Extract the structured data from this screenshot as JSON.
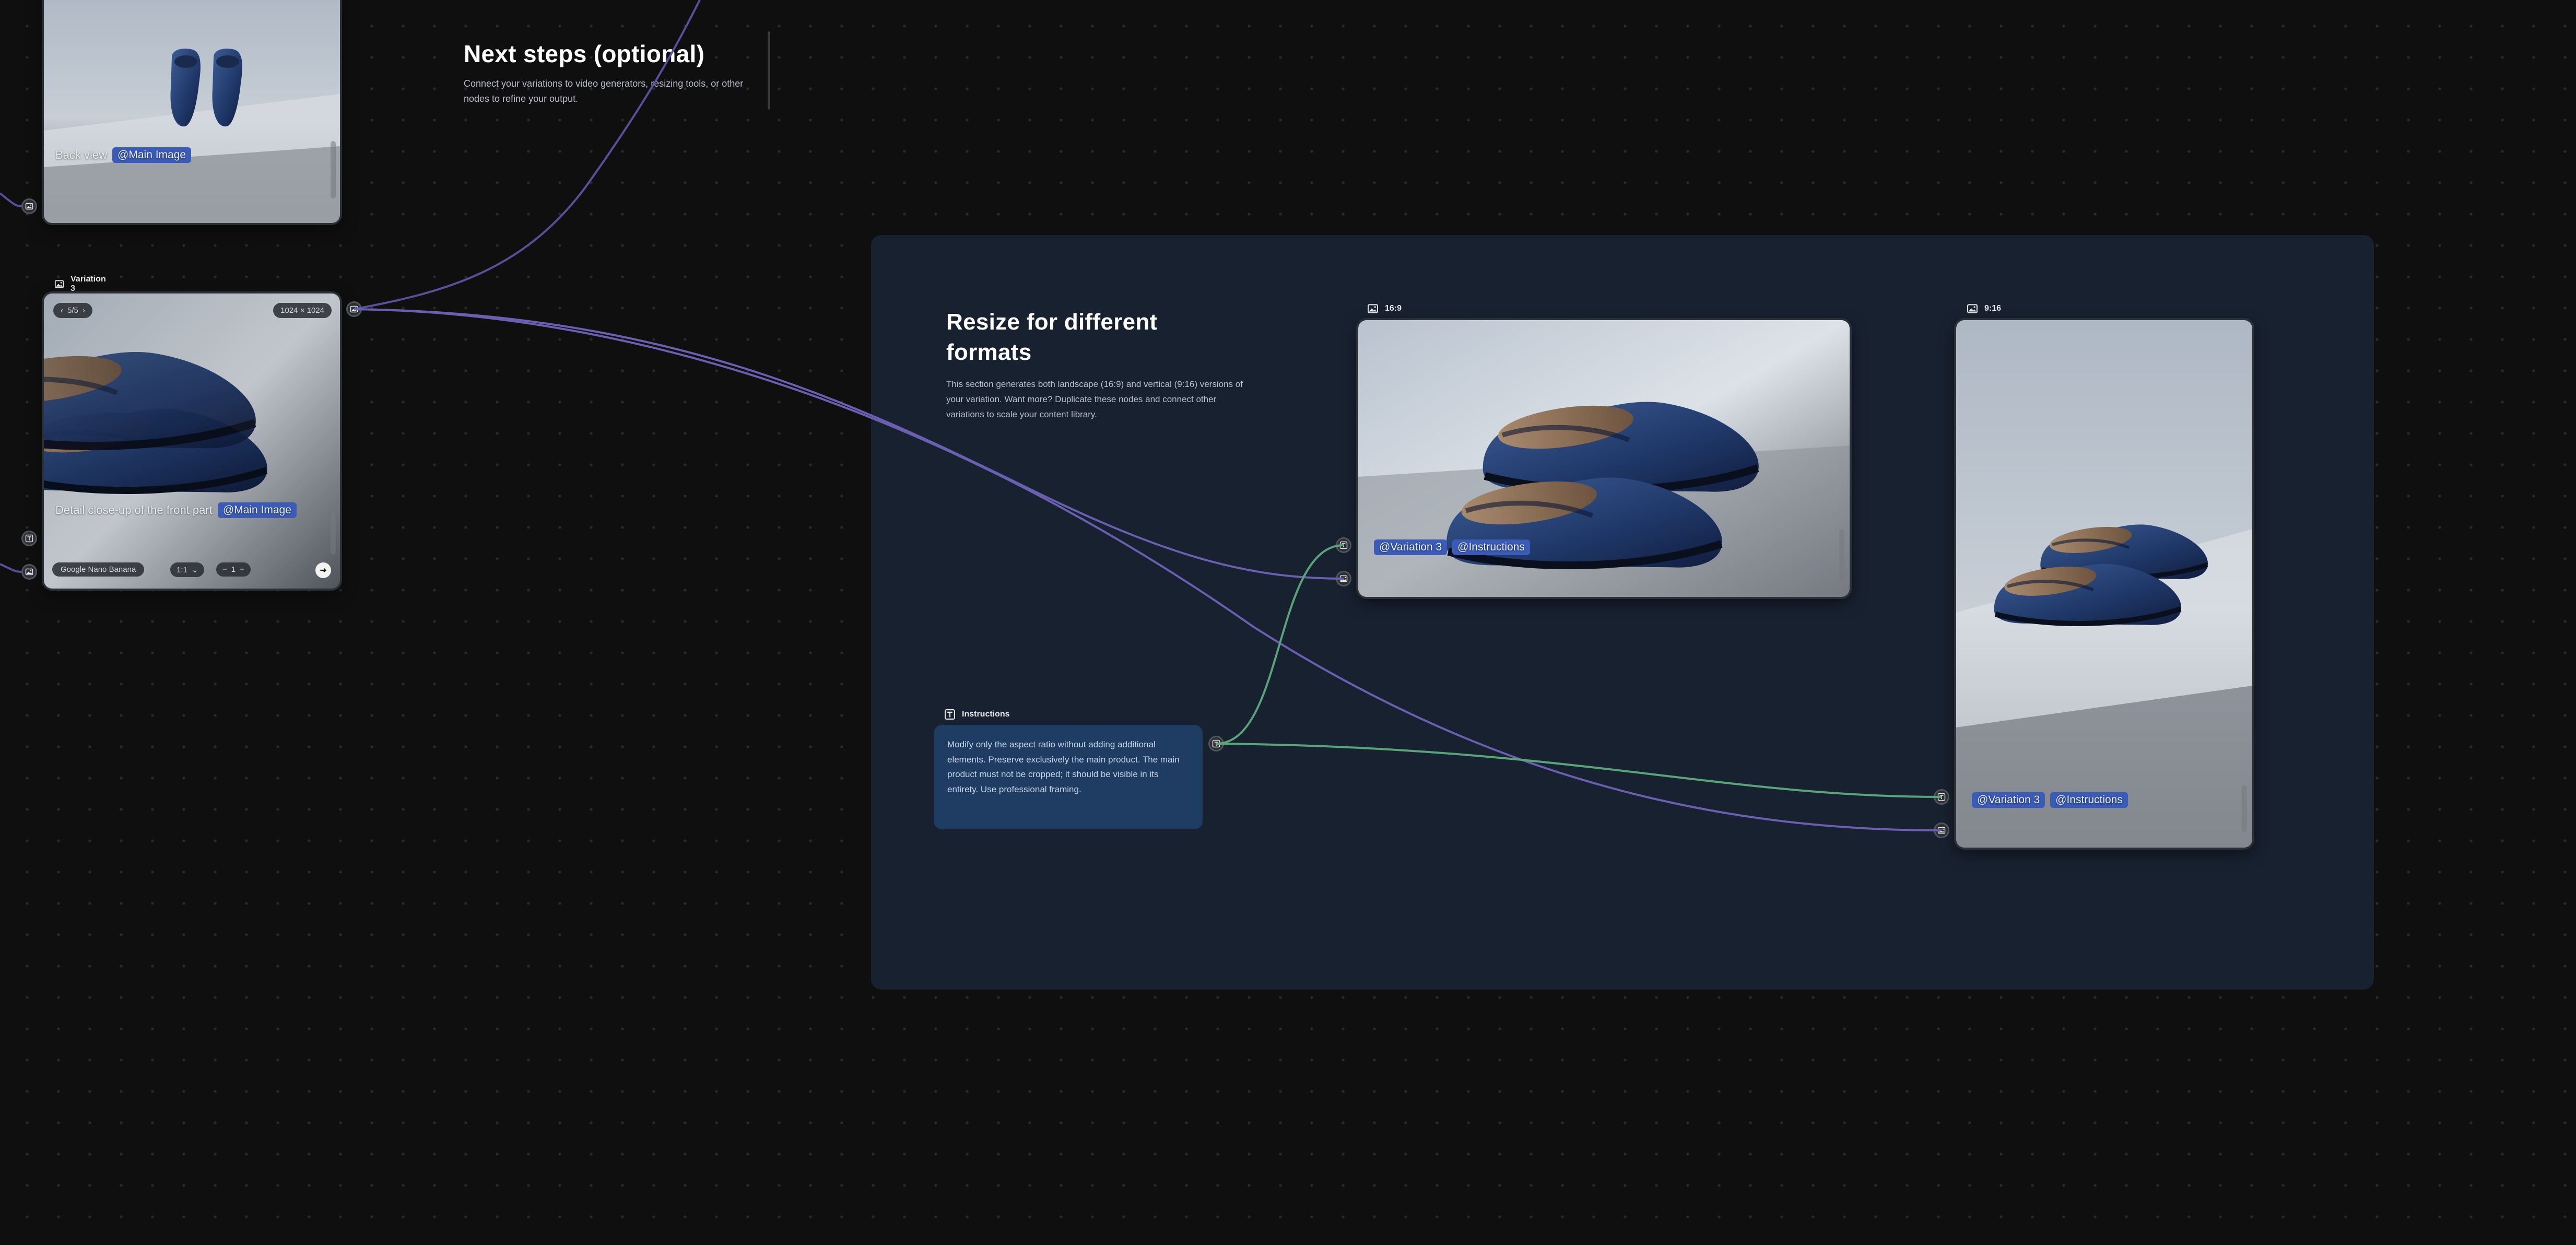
{
  "canvas": {
    "sticky_notes": [
      {
        "title": "Next steps (optional)",
        "description": "Connect your variations to video generators, resizing tools, or other nodes to refine your output."
      },
      {
        "title": "Resize for different formats",
        "description": "This section generates both landscape (16:9) and vertical (9:16) versions of your variation. Want more? Duplicate these nodes and connect other variations to scale your content library."
      }
    ]
  },
  "nodes": {
    "back_view": {
      "prompt": "Back view",
      "tag": "@Main Image"
    },
    "variation3": {
      "header": "Variation 3",
      "counter": "5/5",
      "dimensions": "1024 × 1024",
      "prompt": "Detail close-up of the front part",
      "tag": "@Main Image",
      "model": "Google Nano Banana",
      "aspect": "1:1",
      "quantity": "1"
    },
    "instructions": {
      "header": "Instructions",
      "text": "Modify only the aspect ratio without adding additional elements. Preserve exclusively the main product. The main product must not be cropped; it should be visible in its entirety. Use professional framing."
    },
    "landscape": {
      "header": "16:9",
      "tags": [
        "@Variation 3",
        "@Instructions"
      ]
    },
    "vertical": {
      "header": "9:16",
      "tags": [
        "@Variation 3",
        "@Instructions"
      ]
    }
  },
  "icons": {
    "image": "image-icon",
    "text": "text-icon",
    "prev": "chevron-left-icon",
    "next": "chevron-right-icon",
    "chevron_down": "chevron-down-icon",
    "minus": "minus-icon",
    "plus": "plus-icon",
    "run": "arrow-right-circle-icon"
  },
  "colors": {
    "canvas": "#0f0f10",
    "group": "#182130",
    "wire_image": "#6a5fb0",
    "wire_text": "#5aa47a",
    "tag": "#3b5bb8",
    "instructions_box": "#1f3d63"
  }
}
